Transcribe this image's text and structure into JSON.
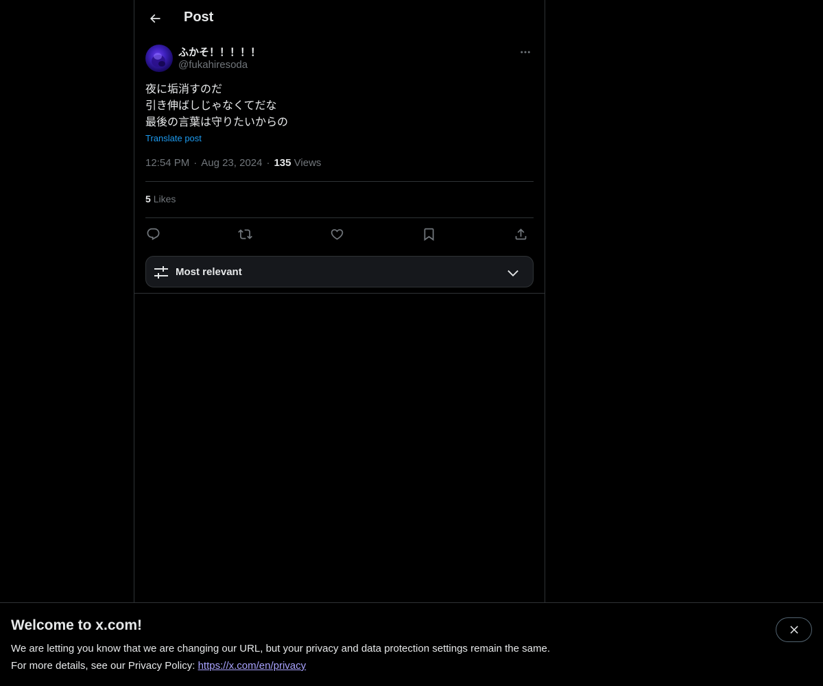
{
  "header": {
    "title": "Post",
    "back_icon": "arrow-left-icon"
  },
  "post": {
    "author": {
      "display_name": "ふかそ！！！！！",
      "handle": "@fukahiresoda"
    },
    "text_lines": [
      "夜に垢消すのだ",
      "引き伸ばしじゃなくてだな",
      "最後の言葉は守りたいからの"
    ],
    "translate_label": "Translate post",
    "time": "12:54 PM",
    "date": "Aug 23, 2024",
    "views_count": "135",
    "views_label": "Views",
    "likes_count": "5",
    "likes_label": "Likes",
    "actions": [
      "reply-icon",
      "repost-icon",
      "like-icon",
      "bookmark-icon",
      "share-icon"
    ]
  },
  "sort": {
    "label": "Most relevant"
  },
  "banner": {
    "title": "Welcome to x.com!",
    "line1": "We are letting you know that we are changing our URL, but your privacy and data protection settings remain the same.",
    "line2_prefix": "For more details, see our Privacy Policy: ",
    "link": "https://x.com/en/privacy"
  },
  "colors": {
    "background": "#000000",
    "text": "#e7e9ea",
    "muted": "#71767b",
    "accent": "#1d9bf0",
    "border": "#2f3336"
  }
}
